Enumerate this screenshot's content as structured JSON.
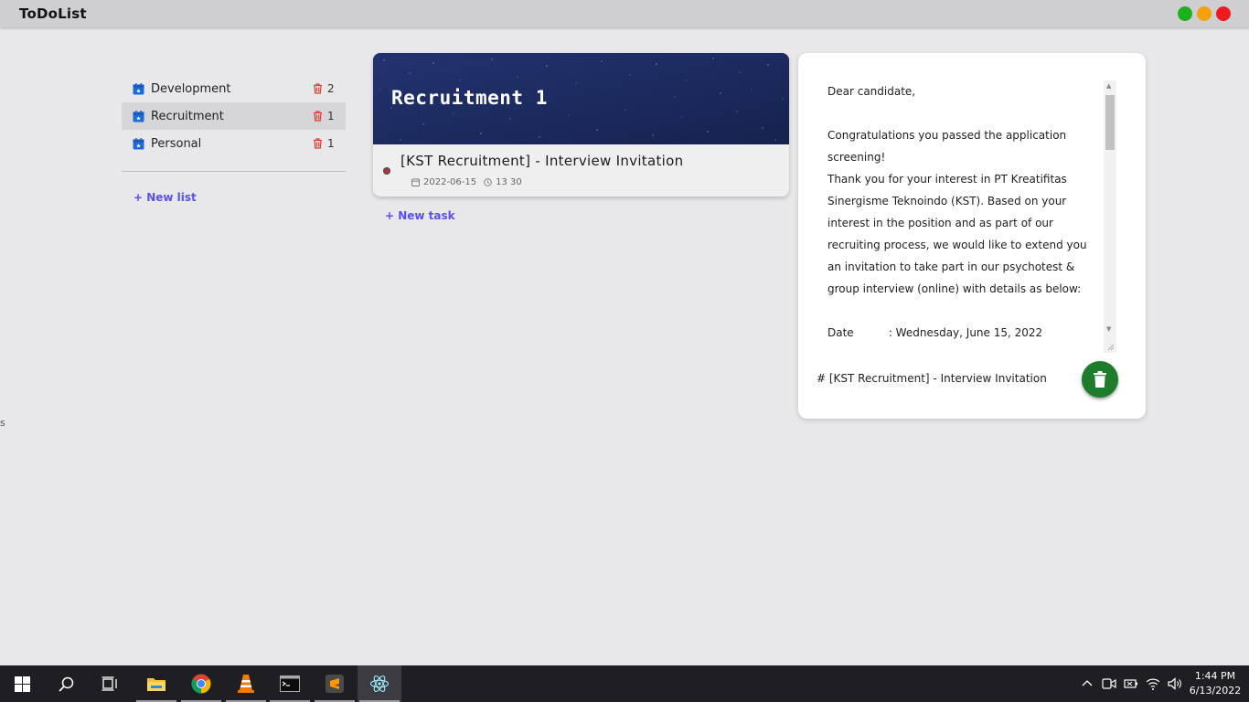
{
  "window": {
    "title": "ToDoList",
    "controls": [
      {
        "name": "maximize",
        "color": "#1db21d"
      },
      {
        "name": "minimize",
        "color": "#f4a10a"
      },
      {
        "name": "close",
        "color": "#ee1c1c"
      }
    ]
  },
  "sidebar": {
    "lists": [
      {
        "label": "Development",
        "count": "2",
        "active": false
      },
      {
        "label": "Recruitment",
        "count": "1",
        "active": true
      },
      {
        "label": "Personal",
        "count": "1",
        "active": false
      }
    ],
    "new_list_label": "+ New list"
  },
  "task_panel": {
    "banner_title": "Recruitment 1",
    "tasks": [
      {
        "title": "[KST Recruitment] - Interview Invitation",
        "date": "2022-06-15",
        "time": "13 30",
        "status_color": "#e02121"
      }
    ],
    "new_task_label": "+ New task"
  },
  "detail": {
    "description": "Dear candidate,\n\nCongratulations you passed the application screening!\nThank you for your interest in PT Kreatifitas Sinergisme Teknoindo (KST). Based on your interest in the position and as part of our recruiting process, we would like to extend you an invitation to take part in our psychotest & group interview (online) with details as below:\n\nDate          : Wednesday, June 15, 2022",
    "title": "# [KST Recruitment] - Interview Invitation"
  },
  "edge_text": "s",
  "taskbar": {
    "apps": [
      "start",
      "search",
      "task-view",
      "file-explorer",
      "chrome",
      "vlc",
      "terminal",
      "sublime-text",
      "electron-app"
    ],
    "time": "1:44 PM",
    "date": "6/13/2022"
  },
  "colors": {
    "accent": "#5a4ff0",
    "list_icon": "#1e6ad8",
    "trash": "#e53935",
    "delete_button": "#1e7d2d"
  }
}
